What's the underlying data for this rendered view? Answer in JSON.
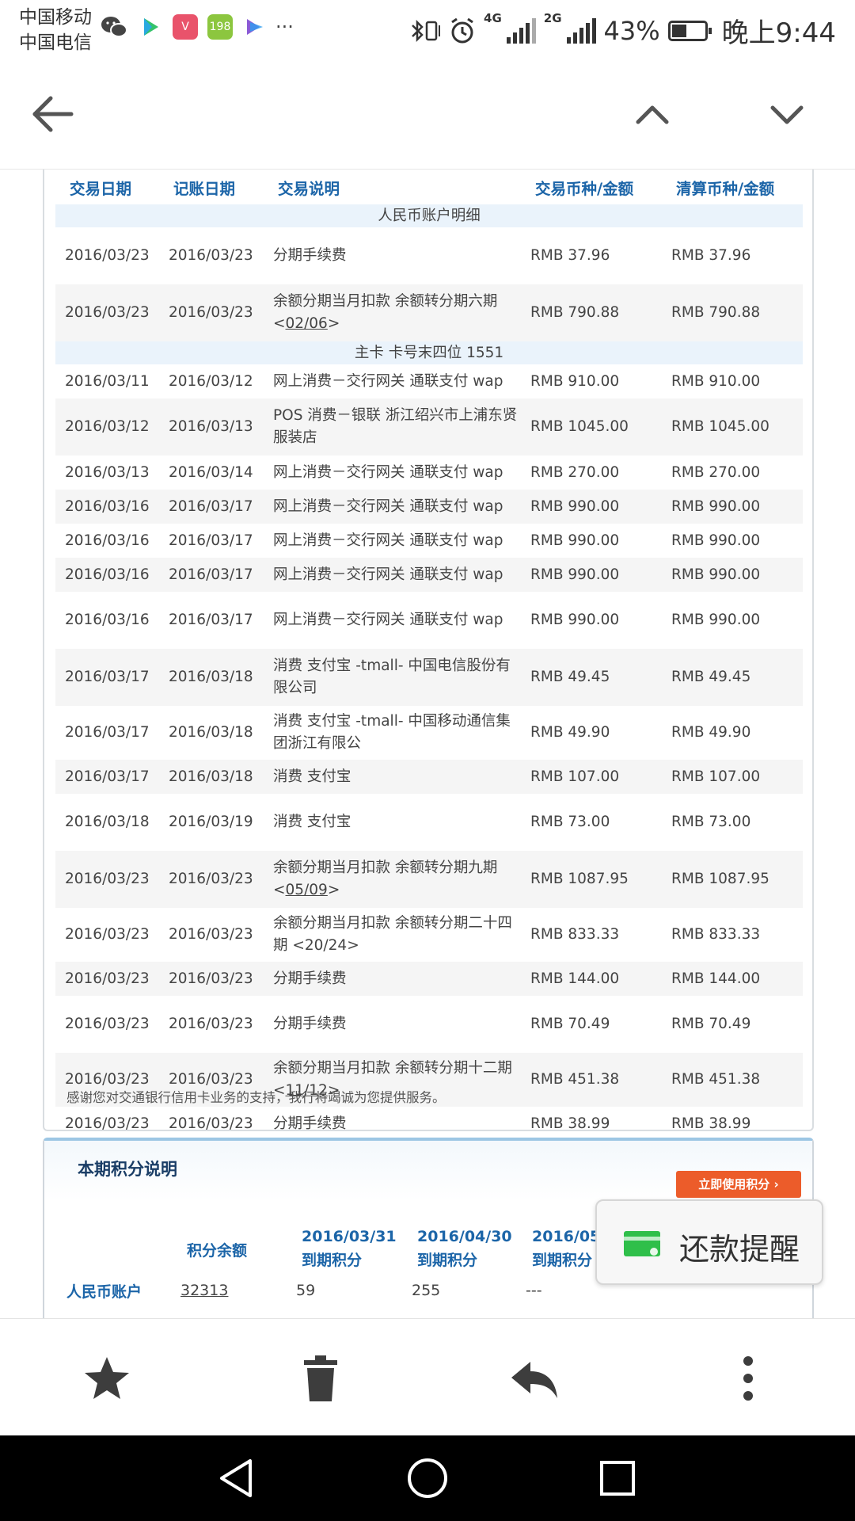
{
  "status_bar": {
    "carrier_1": "中国移动",
    "carrier_2": "中国电信",
    "app_icons": [
      "wechat-icon",
      "video-app-icon",
      "vmall-icon",
      "app-198-icon",
      "app-arrow-icon"
    ],
    "more": "···",
    "net_1": "4G",
    "net_2": "2G",
    "battery_percent": "43%",
    "time": "晚上9:44"
  },
  "transactions_table": {
    "headers": [
      "交易日期",
      "记账日期",
      "交易说明",
      "交易币种/金额",
      "清算币种/金额"
    ],
    "section_rmb": "人民币账户明细",
    "rmb_rows": [
      {
        "trans_date": "2016/03/23",
        "post_date": "2016/03/23",
        "desc": "分期手续费",
        "amount": "RMB 37.96",
        "settle": "RMB 37.96"
      },
      {
        "trans_date": "2016/03/23",
        "post_date": "2016/03/23",
        "desc": "余额分期当月扣款 余额转分期六期",
        "desc_prefix": "<",
        "desc_link": "02/06",
        "desc_suffix": ">",
        "amount": "RMB 790.88",
        "settle": "RMB 790.88"
      }
    ],
    "section_card": "主卡 卡号末四位 1551",
    "card_rows": [
      {
        "trans_date": "2016/03/11",
        "post_date": "2016/03/12",
        "desc": "网上消费－交行网关 通联支付 wap",
        "amount": "RMB 910.00",
        "settle": "RMB 910.00"
      },
      {
        "trans_date": "2016/03/12",
        "post_date": "2016/03/13",
        "desc": "POS 消费－银联 浙江绍兴市上浦东贤服装店",
        "amount": "RMB 1045.00",
        "settle": "RMB 1045.00"
      },
      {
        "trans_date": "2016/03/13",
        "post_date": "2016/03/14",
        "desc": "网上消费－交行网关 通联支付 wap",
        "amount": "RMB 270.00",
        "settle": "RMB 270.00"
      },
      {
        "trans_date": "2016/03/16",
        "post_date": "2016/03/17",
        "desc": "网上消费－交行网关 通联支付 wap",
        "amount": "RMB 990.00",
        "settle": "RMB 990.00"
      },
      {
        "trans_date": "2016/03/16",
        "post_date": "2016/03/17",
        "desc": "网上消费－交行网关 通联支付 wap",
        "amount": "RMB 990.00",
        "settle": "RMB 990.00"
      },
      {
        "trans_date": "2016/03/16",
        "post_date": "2016/03/17",
        "desc": "网上消费－交行网关 通联支付 wap",
        "amount": "RMB 990.00",
        "settle": "RMB 990.00"
      },
      {
        "trans_date": "2016/03/16",
        "post_date": "2016/03/17",
        "desc": "网上消费－交行网关 通联支付 wap",
        "amount": "RMB 990.00",
        "settle": "RMB 990.00"
      },
      {
        "trans_date": "2016/03/17",
        "post_date": "2016/03/18",
        "desc": "消费 支付宝 -tmall- 中国电信股份有限公司",
        "amount": "RMB 49.45",
        "settle": "RMB 49.45"
      },
      {
        "trans_date": "2016/03/17",
        "post_date": "2016/03/18",
        "desc": "消费 支付宝 -tmall- 中国移动通信集团浙江有限公",
        "amount": "RMB 49.90",
        "settle": "RMB 49.90"
      },
      {
        "trans_date": "2016/03/17",
        "post_date": "2016/03/18",
        "desc": "消费 支付宝",
        "amount": "RMB 107.00",
        "settle": "RMB 107.00"
      },
      {
        "trans_date": "2016/03/18",
        "post_date": "2016/03/19",
        "desc": "消费 支付宝",
        "amount": "RMB 73.00",
        "settle": "RMB 73.00"
      },
      {
        "trans_date": "2016/03/23",
        "post_date": "2016/03/23",
        "desc": "余额分期当月扣款 余额转分期九期",
        "desc_prefix": "<",
        "desc_link": "05/09",
        "desc_suffix": ">",
        "amount": "RMB 1087.95",
        "settle": "RMB 1087.95"
      },
      {
        "trans_date": "2016/03/23",
        "post_date": "2016/03/23",
        "desc": "余额分期当月扣款 余额转分期二十四期 <20/24>",
        "amount": "RMB 833.33",
        "settle": "RMB 833.33"
      },
      {
        "trans_date": "2016/03/23",
        "post_date": "2016/03/23",
        "desc": "分期手续费",
        "amount": "RMB 144.00",
        "settle": "RMB 144.00"
      },
      {
        "trans_date": "2016/03/23",
        "post_date": "2016/03/23",
        "desc": "分期手续费",
        "amount": "RMB 70.49",
        "settle": "RMB 70.49"
      },
      {
        "trans_date": "2016/03/23",
        "post_date": "2016/03/23",
        "desc": "余额分期当月扣款 余额转分期十二期",
        "desc_prefix": "<",
        "desc_link": "11/12",
        "desc_suffix": ">",
        "amount": "RMB 451.38",
        "settle": "RMB 451.38"
      },
      {
        "trans_date": "2016/03/23",
        "post_date": "2016/03/23",
        "desc": "分期手续费",
        "amount": "RMB 38.99",
        "settle": "RMB 38.99"
      }
    ],
    "footnote": "感谢您对交通银行信用卡业务的支持，我行将竭诚为您提供服务。"
  },
  "points": {
    "title": "本期积分说明",
    "use_button": "立即使用积分 ›",
    "col_balance": "积分余额",
    "col_1_date": "2016/03/31",
    "col_1_label": "到期积分",
    "col_2_date": "2016/04/30",
    "col_2_label": "到期积分",
    "col_3_date": "2016/05/",
    "col_3_label": "到期积分",
    "row_label": "人民币账户",
    "balance": "32313",
    "exp_1": "59",
    "exp_2": "255",
    "exp_3": "---"
  },
  "reminder": {
    "label": "还款提醒"
  },
  "actions": [
    "star-icon",
    "delete-icon",
    "reply-icon",
    "more-icon"
  ],
  "colors": {
    "header_blue": "#1c65a8",
    "section_bg": "#eaf3fb",
    "accent_orange": "#ec5c2a",
    "wallet_green": "#2fbf4a"
  }
}
